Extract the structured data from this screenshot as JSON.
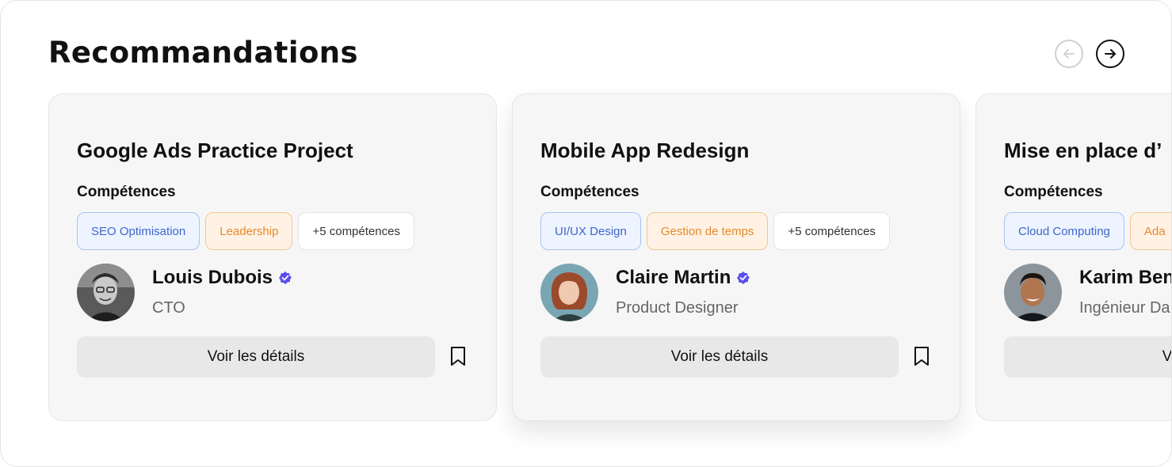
{
  "header": {
    "title": "Recommandations",
    "prev_icon": "arrow-left-icon",
    "next_icon": "arrow-right-icon"
  },
  "cards": [
    {
      "title": "Google Ads Practice Project",
      "skills_label": "Compétences",
      "tags": [
        {
          "label": "SEO Optimisation",
          "color": "blue"
        },
        {
          "label": "Leadership",
          "color": "orange"
        },
        {
          "label": "+5 compétences",
          "color": "neutral"
        }
      ],
      "person": {
        "name": "Louis Dubois",
        "role": "CTO",
        "verified": true
      },
      "button_label": "Voir les détails"
    },
    {
      "title": "Mobile App Redesign",
      "skills_label": "Compétences",
      "tags": [
        {
          "label": "UI/UX Design",
          "color": "blue"
        },
        {
          "label": "Gestion de temps",
          "color": "orange"
        },
        {
          "label": "+5 compétences",
          "color": "neutral"
        }
      ],
      "person": {
        "name": "Claire Martin",
        "role": "Product Designer",
        "verified": true
      },
      "button_label": "Voir les détails"
    },
    {
      "title": "Mise en place d’",
      "skills_label": "Compétences",
      "tags": [
        {
          "label": "Cloud Computing",
          "color": "blue"
        },
        {
          "label": "Ada",
          "color": "orange"
        }
      ],
      "person": {
        "name": "Karim Ben",
        "role": "Ingénieur Da",
        "verified": false
      },
      "button_label": "Voir le"
    }
  ],
  "colors": {
    "verified": "#5b4df0",
    "tag_blue": "#3d66cc",
    "tag_orange": "#e58a2a"
  }
}
